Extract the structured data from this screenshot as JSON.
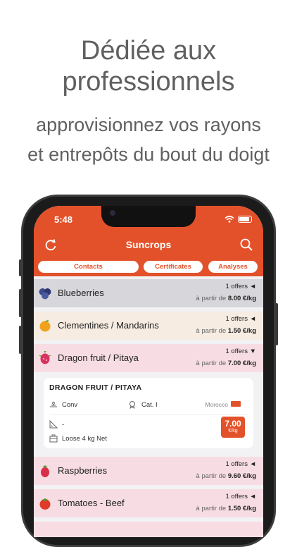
{
  "promo": {
    "title_line1": "Dédiée aux",
    "title_line2": "professionnels",
    "subtitle_line1": "approvisionnez vos rayons",
    "subtitle_line2": "et entrepôts du bout du doigt"
  },
  "status_bar": {
    "time": "5:48"
  },
  "app": {
    "title": "Suncrops"
  },
  "tabs": [
    {
      "label": "Contacts"
    },
    {
      "label": "Certificates"
    },
    {
      "label": "Analyses"
    }
  ],
  "products": [
    {
      "name": "Blueberries",
      "offers": "1 offers",
      "prefix": "à partir de",
      "price": "8.00",
      "unit": "€/kg",
      "arrow": "◄",
      "bg": "#d7d7db",
      "icon": "blueberry-icon"
    },
    {
      "name": "Clementines / Mandarins",
      "offers": "1 offers",
      "prefix": "à partir de",
      "price": "1.50",
      "unit": "€/kg",
      "arrow": "◄",
      "bg": "#f6ece2",
      "icon": "clementine-icon"
    },
    {
      "name": "Dragon fruit / Pitaya",
      "offers": "1 offers",
      "prefix": "à partir de",
      "price": "7.00",
      "unit": "€/kg",
      "arrow": "▼",
      "bg": "#f7dde3",
      "icon": "dragon-fruit-icon"
    },
    {
      "name": "Raspberries",
      "offers": "1 offers",
      "prefix": "à partir de",
      "price": "9.60",
      "unit": "€/kg",
      "arrow": "◄",
      "bg": "#f7dde3",
      "icon": "raspberry-icon"
    },
    {
      "name": "Tomatoes - Beef",
      "offers": "1 offers",
      "prefix": "à partir de",
      "price": "1.50",
      "unit": "€/kg",
      "arrow": "◄",
      "bg": "#f7dde3",
      "icon": "tomato-icon"
    }
  ],
  "detail_card": {
    "title": "DRAGON FRUIT / PITAYA",
    "cultivation": "Conv",
    "category": "Cat. I",
    "origin": "Morocco",
    "caliber": "-",
    "packaging": "Loose 4 kg Net",
    "price": "7.00",
    "unit": "€/kg"
  },
  "colors": {
    "accent": "#e3512a"
  }
}
